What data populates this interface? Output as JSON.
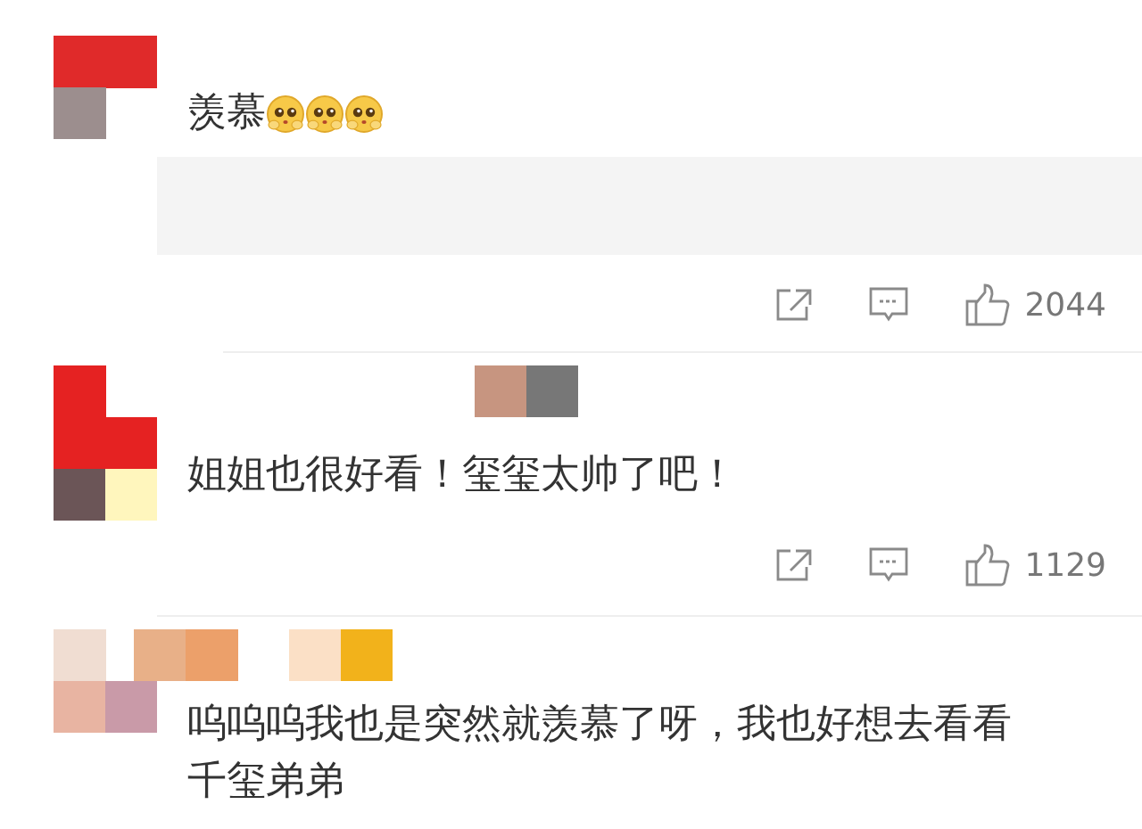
{
  "comments": [
    {
      "text": "羡慕",
      "emoji": [
        {
          "kind": "pleading"
        },
        {
          "kind": "pleading"
        },
        {
          "kind": "pleading"
        }
      ],
      "has_reply_box": true,
      "likes": "2044"
    },
    {
      "text": "姐姐也很好看！玺玺太帅了吧！",
      "has_reply_box": false,
      "likes": "1129"
    },
    {
      "text": "呜呜呜我也是突然就羡慕了呀，我也好想去看看千玺弟弟",
      "has_reply_box": false
    }
  ]
}
